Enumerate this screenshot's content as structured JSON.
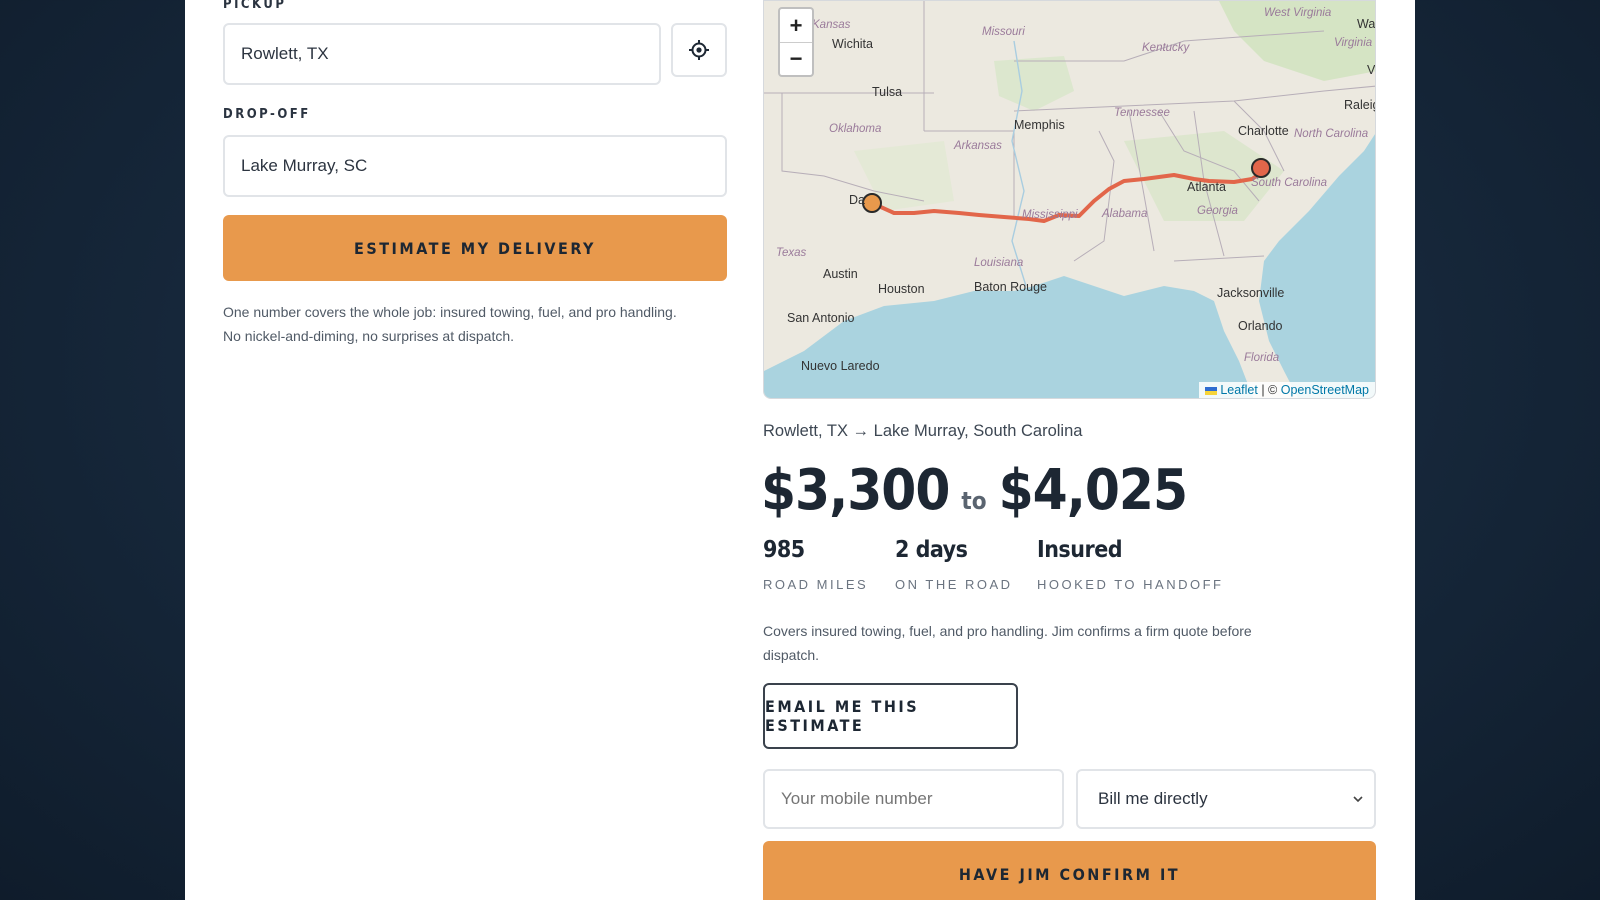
{
  "form": {
    "pickup_label": "PICKUP",
    "pickup_value": "Rowlett, TX",
    "dropoff_label": "DROP-OFF",
    "dropoff_value": "Lake Murray, SC",
    "estimate_button": "ESTIMATE MY DELIVERY",
    "note_line1": "One number covers the whole job: insured towing, fuel, and pro handling.",
    "note_line2": "No nickel-and-diming, no surprises at dispatch.",
    "locate_icon": "crosshair-icon"
  },
  "map": {
    "zoom_in": "+",
    "zoom_out": "−",
    "attribution_leaflet": "Leaflet",
    "attribution_sep": "| ©",
    "attribution_osm": "OpenStreetMap",
    "labels": {
      "kansas": "Kansas",
      "missouri": "Missouri",
      "kentucky": "Kentucky",
      "west_virginia": "West Virginia",
      "wash": "Wash",
      "virginia": "Virginia",
      "vi": "Vi",
      "wichita": "Wichita",
      "tulsa": "Tulsa",
      "memphis": "Memphis",
      "raleigh": "Raleigh",
      "tennessee": "Tennessee",
      "charlotte": "Charlotte",
      "north_carolina": "North Carolina",
      "oklahoma": "Oklahoma",
      "arkansas": "Arkansas",
      "atlanta": "Atlanta",
      "south_carolina": "South Carolina",
      "dallas": "Da",
      "mississippi": "Mississippi",
      "alabama": "Alabama",
      "georgia": "Georgia",
      "texas": "Texas",
      "louisiana": "Louisiana",
      "austin": "Austin",
      "houston": "Houston",
      "baton_rouge": "Baton Rouge",
      "jacksonville": "Jacksonville",
      "san_antonio": "San Antonio",
      "orlando": "Orlando",
      "florida": "Florida",
      "nuevo_laredo": "Nuevo Laredo"
    }
  },
  "estimate": {
    "route": "Rowlett, TX → Lake Murray, South Carolina",
    "price_low": "$3,300",
    "price_to": "to",
    "price_high": "$4,025",
    "stats": [
      {
        "value": "985",
        "label": "ROAD MILES"
      },
      {
        "value": "2 days",
        "label": "ON THE ROAD"
      },
      {
        "value": "Insured",
        "label": "HOOKED TO HANDOFF"
      }
    ],
    "note_line1": "Covers insured towing, fuel, and pro handling. Jim confirms a firm quote before",
    "note_line2": "dispatch.",
    "email_button": "EMAIL ME THIS ESTIMATE",
    "mobile_placeholder": "Your mobile number",
    "billing_selected": "Bill me directly",
    "confirm_button": "HAVE JIM CONFIRM IT"
  },
  "colors": {
    "accent": "#e8994c",
    "route_line": "#e2664a",
    "water": "#aad3df",
    "land": "#ece9e0"
  }
}
